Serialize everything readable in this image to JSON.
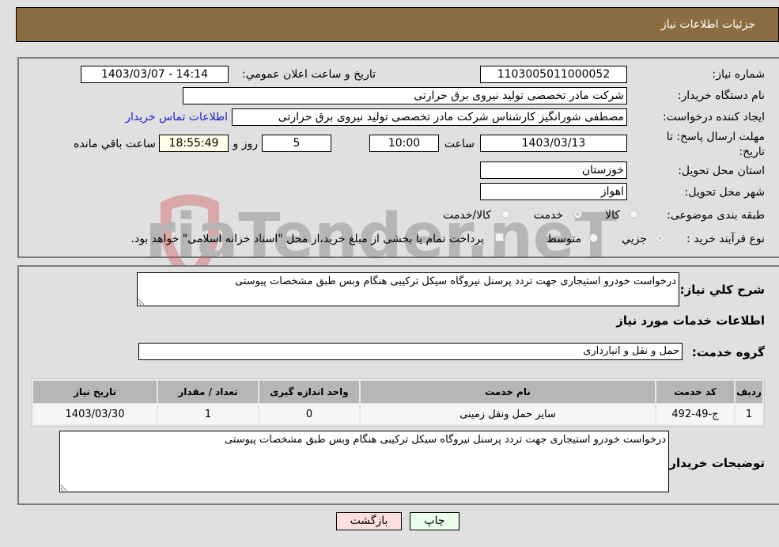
{
  "header": {
    "title": "جزئیات اطلاعات نیاز"
  },
  "form": {
    "need_number": {
      "label": "شماره نیاز:",
      "value": "1103005011000052"
    },
    "announce_datetime": {
      "label": "تاریخ و ساعت اعلان عمومي:",
      "value": "1403/03/07 - 14:14"
    },
    "buyer_org": {
      "label": "نام دستگاه خریدار:",
      "value": "شرکت مادر تخصصی تولید نیروی برق حرارتی"
    },
    "requester": {
      "label": "ایجاد کننده درخواست:",
      "value": "مصطفی شورانگیز کارشناس شرکت مادر تخصصی تولید نیروی برق حرارتی"
    },
    "buyer_contact_link": "اطلاعات تماس خریدار",
    "deadline": {
      "label": "مهلت ارسال پاسخ: تا تاریخ:",
      "date": "1403/03/13",
      "time_label": "ساعت",
      "time": "10:00",
      "days": "5",
      "days_label": "روز و",
      "remaining": "18:55:49",
      "remaining_label": "ساعت باقي مانده"
    },
    "province": {
      "label": "استان محل تحویل:",
      "value": "خوزستان"
    },
    "city": {
      "label": "شهر محل تحویل:",
      "value": "اهواز"
    },
    "category": {
      "label": "طبقه بندی موضوعی:",
      "options": [
        {
          "label": "کالا",
          "checked": false
        },
        {
          "label": "خدمت",
          "checked": true
        },
        {
          "label": "کالا/خدمت",
          "checked": false
        }
      ]
    },
    "purchase_type": {
      "label": "نوع فرآیند خرید :",
      "options": [
        {
          "label": "جزيي",
          "checked": true
        },
        {
          "label": "متوسط",
          "checked": false
        }
      ],
      "treasury_checkbox_label": "پرداخت تمام یا بخشی از مبلغ خرید،از محل \"اسناد خزانه اسلامی\" خواهد بود.",
      "treasury_checked": false
    }
  },
  "details": {
    "general_desc_label": "شرح کلي نیاز:",
    "general_desc": "درخواست خودرو استیجاری جهت تردد پرسنل نیروگاه سیکل ترکیبی هنگام وبس طبق مشخصات پیوستی",
    "services_heading": "اطلاعات خدمات مورد نیاز",
    "service_group_label": "گروه خدمت:",
    "service_group": "حمل و نقل و انبارداری",
    "table": {
      "headers": [
        "ردیف",
        "کد خدمت",
        "نام خدمت",
        "واحد اندازه گیری",
        "تعداد / مقدار",
        "تاریخ نیاز"
      ],
      "rows": [
        [
          "1",
          "ج-49-492",
          "سایر حمل ونقل زمینی",
          "0",
          "1",
          "1403/03/30"
        ]
      ]
    },
    "buyer_notes_label": "توضیحات خریدار:",
    "buyer_notes": "درخواست خودرو استیجاری جهت تردد پرسنل نیروگاه سیکل ترکیبی هنگام وبس طبق مشخصات پیوستی"
  },
  "buttons": {
    "print": "چاپ",
    "back": "بازگشت"
  },
  "watermark": "AriaTender.neT",
  "colors": {
    "header_bg": "#8c6d42",
    "print_btn_bg": "#eaffea",
    "back_btn_bg": "#ffdede",
    "link": "#2222cc"
  }
}
